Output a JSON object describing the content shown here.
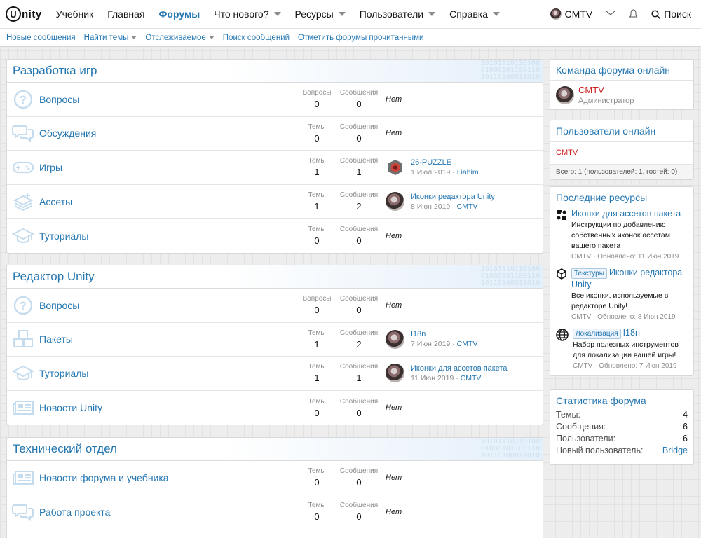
{
  "nav": {
    "logo_letter": "U",
    "logo_text": "nity",
    "items": [
      {
        "label": "Учебник",
        "caret": false,
        "active": false
      },
      {
        "label": "Главная",
        "caret": false,
        "active": false
      },
      {
        "label": "Форумы",
        "caret": false,
        "active": true
      },
      {
        "label": "Что нового?",
        "caret": true,
        "active": false
      },
      {
        "label": "Ресурсы",
        "caret": true,
        "active": false
      },
      {
        "label": "Пользователи",
        "caret": true,
        "active": false
      },
      {
        "label": "Справка",
        "caret": true,
        "active": false
      }
    ],
    "username": "CMTV",
    "search_label": "Поиск"
  },
  "subnav": {
    "items": [
      {
        "label": "Новые сообщения",
        "caret": false
      },
      {
        "label": "Найти темы",
        "caret": true
      },
      {
        "label": "Отслеживаемое",
        "caret": true
      },
      {
        "label": "Поиск сообщений",
        "caret": false
      },
      {
        "label": "Отметить форумы прочитанными",
        "caret": false
      }
    ]
  },
  "binary_text": "10101110110100\n01000101100110\n10110100011010",
  "categories": [
    {
      "title": "Разработка игр",
      "forums": [
        {
          "title": "Вопросы",
          "icon": "question-icon",
          "label1": "Вопросы",
          "val1": "0",
          "label2": "Сообщения",
          "val2": "0",
          "last": {
            "none": "Нет"
          }
        },
        {
          "title": "Обсуждения",
          "icon": "discussion-icon",
          "label1": "Темы",
          "val1": "0",
          "label2": "Сообщения",
          "val2": "0",
          "last": {
            "none": "Нет"
          }
        },
        {
          "title": "Игры",
          "icon": "gamepad-icon",
          "label1": "Темы",
          "val1": "1",
          "label2": "Сообщения",
          "val2": "1",
          "last": {
            "title": "26-PUZZLE",
            "date": "1 Июл 2019",
            "user": "Liahim",
            "thumb": "puzzle"
          }
        },
        {
          "title": "Ассеты",
          "icon": "assets-icon",
          "label1": "Темы",
          "val1": "1",
          "label2": "Сообщения",
          "val2": "2",
          "last": {
            "title": "Иконки редактора Unity",
            "date": "8 Июн 2019",
            "user": "CMTV",
            "thumb": "avatar"
          }
        },
        {
          "title": "Туториалы",
          "icon": "graduation-cap-icon",
          "label1": "Темы",
          "val1": "0",
          "label2": "Сообщения",
          "val2": "0",
          "last": {
            "none": "Нет"
          }
        }
      ]
    },
    {
      "title": "Редактор Unity",
      "forums": [
        {
          "title": "Вопросы",
          "icon": "question-icon",
          "label1": "Вопросы",
          "val1": "0",
          "label2": "Сообщения",
          "val2": "0",
          "last": {
            "none": "Нет"
          }
        },
        {
          "title": "Пакеты",
          "icon": "packages-icon",
          "label1": "Темы",
          "val1": "1",
          "label2": "Сообщения",
          "val2": "2",
          "last": {
            "title": "I18n",
            "date": "7 Июн 2019",
            "user": "CMTV",
            "thumb": "avatar"
          }
        },
        {
          "title": "Туториалы",
          "icon": "graduation-cap-icon",
          "label1": "Темы",
          "val1": "1",
          "label2": "Сообщения",
          "val2": "1",
          "last": {
            "title": "Иконки для ассетов пакета",
            "date": "11 Июн 2019",
            "user": "CMTV",
            "thumb": "avatar"
          }
        },
        {
          "title": "Новости Unity",
          "icon": "news-icon",
          "label1": "Темы",
          "val1": "0",
          "label2": "Сообщения",
          "val2": "0",
          "last": {
            "none": "Нет"
          }
        }
      ]
    },
    {
      "title": "Технический отдел",
      "forums": [
        {
          "title": "Новости форума и учебника",
          "icon": "news-icon",
          "label1": "Темы",
          "val1": "0",
          "label2": "Сообщения",
          "val2": "0",
          "last": {
            "none": "Нет"
          }
        },
        {
          "title": "Работа проекта",
          "icon": "discussion-icon",
          "label1": "Темы",
          "val1": "0",
          "label2": "Сообщения",
          "val2": "0",
          "last": {
            "none": "Нет"
          }
        }
      ]
    }
  ],
  "sidebar": {
    "staff": {
      "title": "Команда форума онлайн",
      "name": "CMTV",
      "role": "Администратор"
    },
    "online": {
      "title": "Пользователи онлайн",
      "names": "CMTV",
      "footer": "Всего: 1 (пользователей: 1, гостей: 0)"
    },
    "resources": {
      "title": "Последние ресурсы",
      "items": [
        {
          "icon": "puzzle-pieces-icon",
          "tag": "",
          "title": "Иконки для ассетов пакета",
          "desc": "Инструкции по добавлению собственных иконок ассетам вашего пакета",
          "meta": "CMTV · Обновлено: 11 Июн 2019"
        },
        {
          "icon": "unity-editor-icon",
          "tag": "Текстуры",
          "title": "Иконки редактора Unity",
          "desc": "Все иконки, используемые в редакторе Unity!",
          "meta": "CMTV · Обновлено: 8 Июн 2019"
        },
        {
          "icon": "globe-icon",
          "tag": "Локализация",
          "title": "I18n",
          "desc": "Набор полезных инструментов для локализации вашей игры!",
          "meta": "CMTV · Обновлено: 7 Июн 2019"
        }
      ]
    },
    "stats": {
      "title": "Статистика форума",
      "rows": [
        {
          "label": "Темы:",
          "value": "4",
          "link": false
        },
        {
          "label": "Сообщения:",
          "value": "6",
          "link": false
        },
        {
          "label": "Пользователи:",
          "value": "6",
          "link": false
        },
        {
          "label": "Новый пользователь:",
          "value": "Bridge",
          "link": true
        }
      ]
    }
  },
  "colors": {
    "link": "#2577b1",
    "staff": "#cc1f1f",
    "icon": "#c5dcef"
  }
}
